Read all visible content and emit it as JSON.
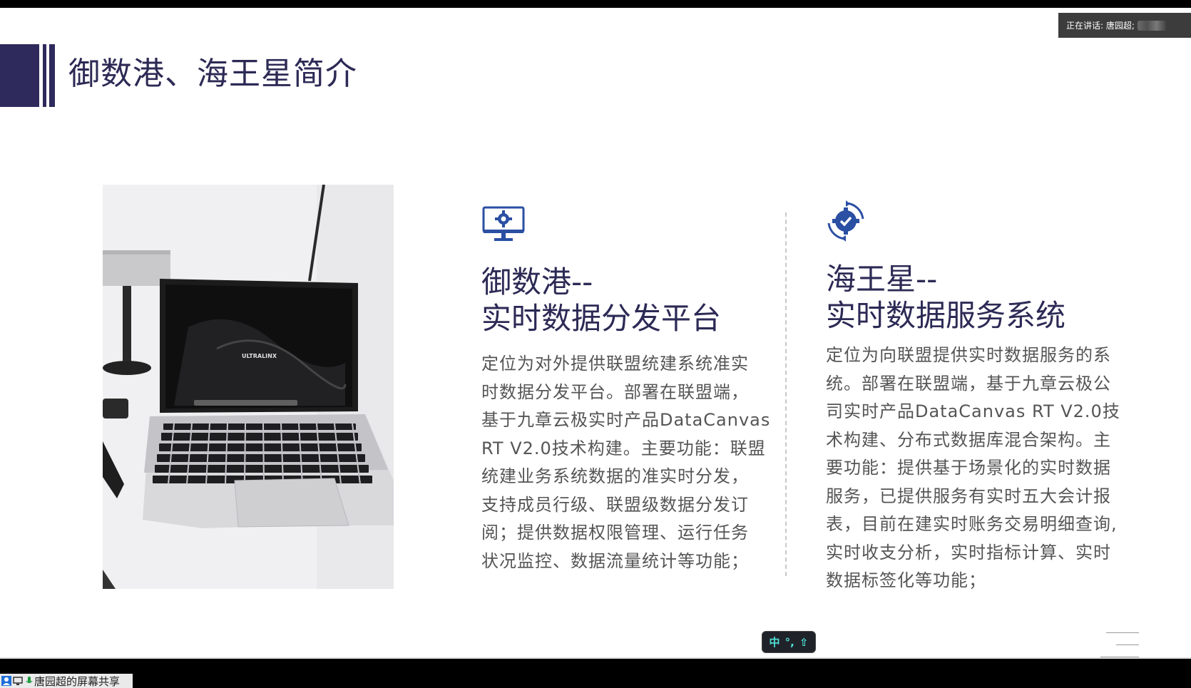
{
  "slide": {
    "title": "御数港、海王星简介"
  },
  "photo": {
    "screen_brand": "ULTRALINX"
  },
  "left_column": {
    "icon": "monitor-gear-icon",
    "heading_line1": "御数港--",
    "heading_line2": "实时数据分发平台",
    "body_lines": [
      "定位为对外提供联盟统建系统准实",
      "时数据分发平台。部署在联盟端，",
      "基于九章云极实时产品DataCanvas",
      "RT V2.0技术构建。主要功能：联盟",
      "统建业务系统数据的准实时分发，",
      "支持成员行级、联盟级数据分发订",
      "阅；提供数据权限管理、运行任务",
      "状况监控、数据流量统计等功能；"
    ]
  },
  "right_column": {
    "icon": "gear-check-cycle-icon",
    "heading_line1": "海王星--",
    "heading_line2": "实时数据服务系统",
    "body_lines": [
      "定位为向联盟提供实时数据服务的系",
      "统。部署在联盟端，基于九章云极公",
      "司实时产品DataCanvas RT V2.0技",
      "术构建、分布式数据库混合架构。主",
      "要功能：提供基于场景化的实时数据",
      "服务，已提供服务有实时五大会计报",
      "表，目前在建实时账务交易明细查询,",
      "实时收支分析，实时指标计算、实时",
      "数据标签化等功能；"
    ]
  },
  "overlay": {
    "speaking_label": "正在讲话: 唐园超;",
    "ime": {
      "lang": "中",
      "punct": "°,",
      "shift_icon": "shift-arrow-icon"
    },
    "share_label": "唐园超的屏幕共享"
  },
  "colors": {
    "title_accent": "#2f2a5c",
    "heading_text": "#2c2a55",
    "icon_blue": "#2b4fa3",
    "body_text": "#555555",
    "ime_text": "#4fe0d8"
  }
}
